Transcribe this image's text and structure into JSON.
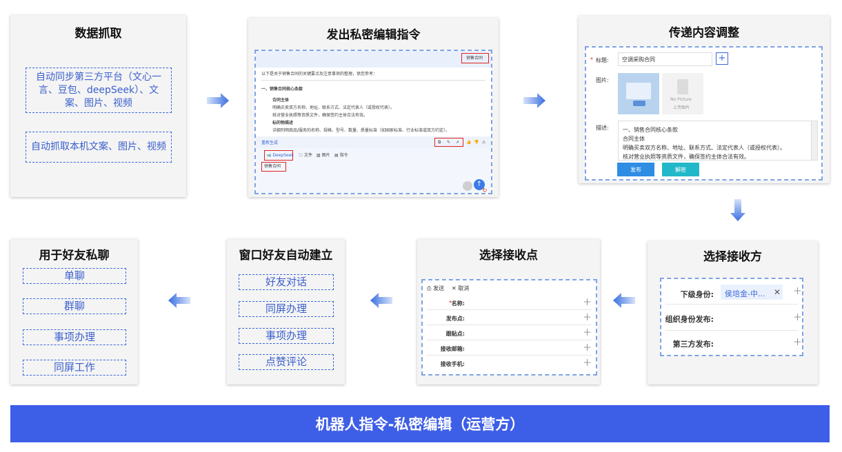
{
  "cards": {
    "data_capture": {
      "title": "数据抓取",
      "items": [
        "自动同步第三方平台（文心一言、豆包、deepSeek）、文案、图片、视频",
        "自动抓取本机文案、图片、视频"
      ]
    },
    "private_edit": {
      "title": "发出私密编辑指令",
      "shot": {
        "tag_button": "销售合同",
        "intro": "以下是关于销售合同的关键要点及注意事项的整理，供您参考：",
        "heading": "一、销售合同核心条款",
        "sub1": "合同主体",
        "line1": "明确买卖双方名称、地址、联系方式、法定代表人（或授权代表）。",
        "line2": "核对营业执照等资质文件，确保签约主体合法有效。",
        "sub2": "标的物描述",
        "line3": "详细列明商品/服务的名称、规格、型号、数量、质量标准（如国家标准、行业标准或双方约定）。",
        "regen": "重新生成",
        "model": "DeepSeek",
        "tools": [
          "文件",
          "图片",
          "指令"
        ],
        "input_value": "销售合同"
      }
    },
    "content_adjust": {
      "title": "传递内容调整",
      "form": {
        "title_label": "标题:",
        "title_value": "空调采购合同",
        "image_label": "图片:",
        "no_picture": "No Picture",
        "upload_picture": "上传图片",
        "desc_label": "描述:",
        "desc_lines": [
          "一、销售合同核心条款",
          "合同主体",
          "明确买卖双方名称、地址、联系方式、法定代表人（或授权代表）。",
          "核对营业执照等资质文件，确保签约主体合法有效。"
        ],
        "publish": "发布",
        "decrypt": "解密"
      }
    },
    "choose_receiver": {
      "title": "选择接收方",
      "rows": [
        {
          "label": "下级身份:",
          "value": "侯培金-中..."
        },
        {
          "label": "组织身份发布:",
          "value": ""
        },
        {
          "label": "第三方发布:",
          "value": ""
        }
      ]
    },
    "choose_point": {
      "title": "选择接收点",
      "toolbar": {
        "send": "发送",
        "cancel": "取消"
      },
      "rows": [
        "名称:",
        "发布点:",
        "跟贴点:",
        "接收邮箱:",
        "接收手机:"
      ]
    },
    "window_friend": {
      "title": "窗口好友自动建立",
      "items": [
        "好友对话",
        "同屏办理",
        "事项办理",
        "点赞评论"
      ]
    },
    "private_chat": {
      "title": "用于好友私聊",
      "items": [
        "单聊",
        "群聊",
        "事项办理",
        "同屏工作"
      ]
    }
  },
  "banner": "机器人指令-私密编辑（运营方）",
  "colors": {
    "accent": "#3d5ee6",
    "arrow": "#3a6fe0",
    "dash": "#3a67d8",
    "red": "#e02020"
  }
}
